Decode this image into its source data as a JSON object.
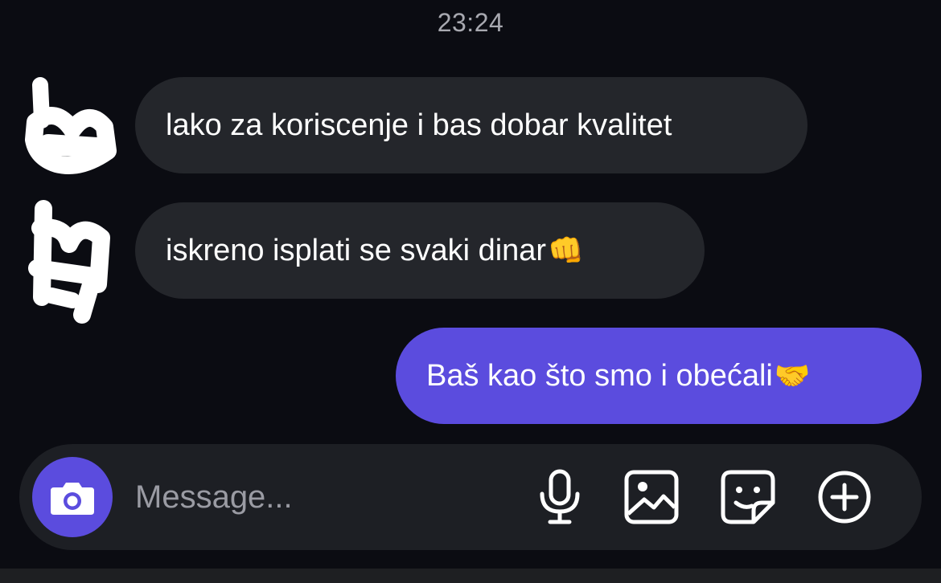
{
  "conversation": {
    "timestamp": "23:24"
  },
  "messages": [
    {
      "direction": "incoming",
      "text": "lako za koriscenje i bas dobar kvalitet",
      "emoji": ""
    },
    {
      "direction": "incoming",
      "text": "iskreno isplati se svaki dinar",
      "emoji": "👊"
    },
    {
      "direction": "outgoing",
      "text": "Baš kao što smo i obećali",
      "emoji": "🤝"
    }
  ],
  "composer": {
    "placeholder": "Message...",
    "value": "",
    "icons": {
      "camera": "camera-icon",
      "mic": "microphone-icon",
      "gallery": "image-icon",
      "sticker": "sticker-icon",
      "add": "plus-circle-icon"
    }
  },
  "colors": {
    "background": "#0b0c12",
    "incoming_bubble": "#24262b",
    "outgoing_bubble": "#5b4cde",
    "composer": "#1d1f24",
    "accent": "#5b4cde",
    "timestamp_text": "#a8a9b0",
    "placeholder_text": "#9a9ba3"
  }
}
